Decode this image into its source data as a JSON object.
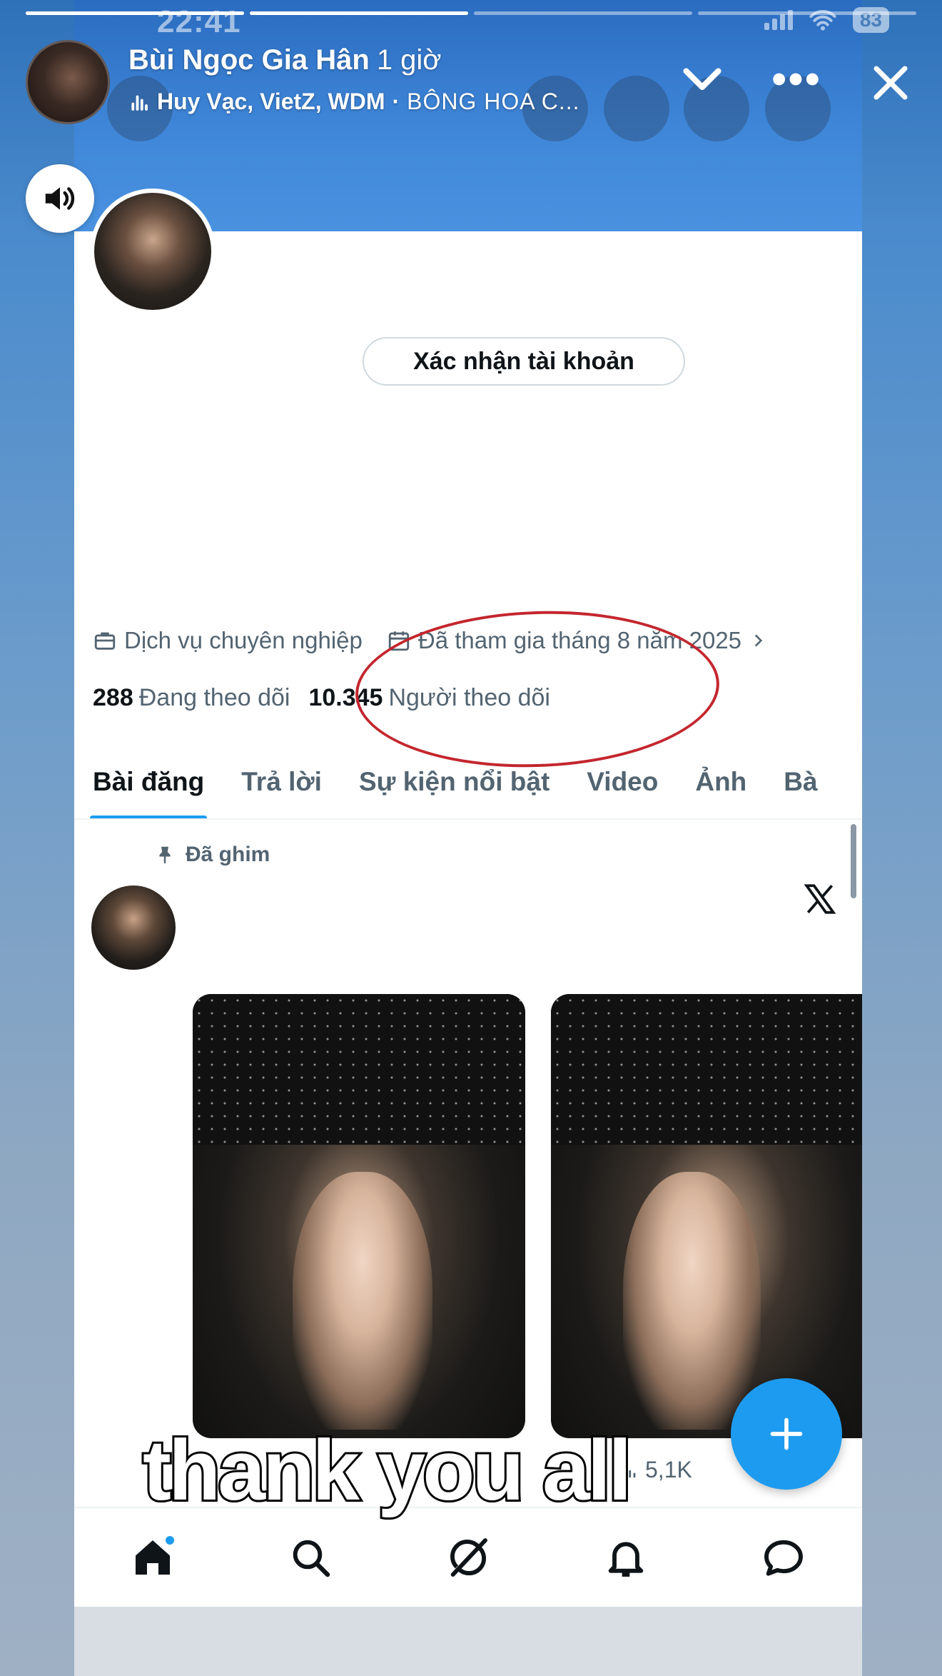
{
  "status_bar": {
    "time": "22:41",
    "battery": "83"
  },
  "story": {
    "progress": [
      1.0,
      1.0,
      0.0,
      0.0
    ],
    "user_name": "Bùi Ngọc Gia Hân",
    "time_ago": "1 giờ",
    "music_artists": "Huy Vạc, VietZ, WDM",
    "music_separator": "·",
    "music_title": "BÔNG HOA C...",
    "caption": "thank you all"
  },
  "profile": {
    "verify_button": "Xác nhận tài khoản",
    "category": "Dịch vụ chuyên nghiệp",
    "joined": "Đã tham gia tháng 8 năm 2025",
    "following_count": "288",
    "following_label": "Đang theo dõi",
    "followers_count": "10.345",
    "followers_label": "Người theo dõi"
  },
  "tabs": [
    {
      "label": "Bài đăng",
      "active": true
    },
    {
      "label": "Trả lời"
    },
    {
      "label": "Sự kiện nổi bật"
    },
    {
      "label": "Video"
    },
    {
      "label": "Ảnh"
    },
    {
      "label": "Bà"
    }
  ],
  "post": {
    "pinned_label": "Đã ghim",
    "views": "5,1K"
  },
  "colors": {
    "accent": "#1d9bf0",
    "annotation": "#c4262e",
    "banner": "#3f86d8"
  },
  "icons": [
    "sound-icon",
    "chevron-down-icon",
    "more-icon",
    "close-icon",
    "briefcase-icon",
    "calendar-icon",
    "pin-icon",
    "x-logo-icon",
    "home-icon",
    "search-icon",
    "grok-icon",
    "bell-icon",
    "message-icon",
    "plus-icon",
    "views-icon"
  ]
}
